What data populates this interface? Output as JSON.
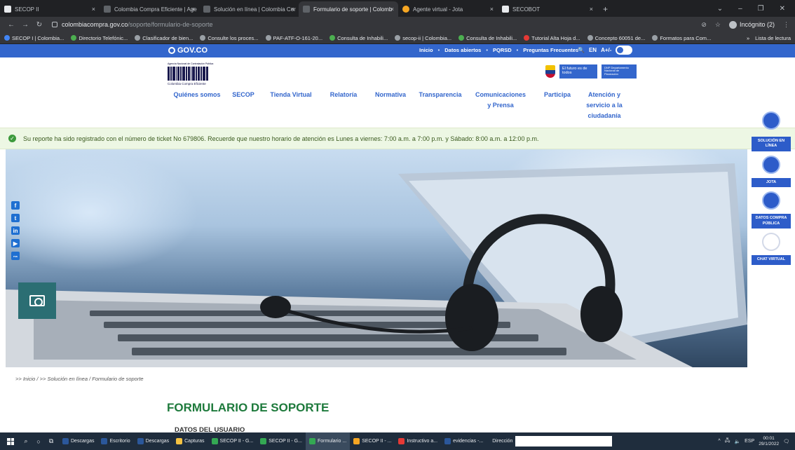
{
  "browser": {
    "tabs": [
      {
        "label": "SECOP II",
        "favicon": "white",
        "active": false
      },
      {
        "label": "Colombia Compra Eficiente | Age",
        "favicon": "gray",
        "active": false
      },
      {
        "label": "Solución en línea | Colombia Cor",
        "favicon": "gray",
        "active": false
      },
      {
        "label": "Formulario de soporte | Colomb",
        "favicon": "gray",
        "active": true
      },
      {
        "label": "Agente virtual - Jota",
        "favicon": "orange",
        "active": false
      },
      {
        "label": "SECOBOT",
        "favicon": "white",
        "active": false
      }
    ],
    "close_glyph": "×",
    "new_tab_glyph": "+",
    "window_controls": {
      "chevron": "⌄",
      "minimize": "–",
      "restore": "❐",
      "close": "✕"
    },
    "url_host": "colombiacompra.gov.co",
    "url_path": "/soporte/formulario-de-soporte",
    "incognito_label": "Incógnito (2)",
    "bookmarks": [
      {
        "label": "SECOP I | Colombia...",
        "color": "blue"
      },
      {
        "label": "Directorio Telefónic...",
        "color": "green"
      },
      {
        "label": "Clasificador de bien...",
        "color": "gray"
      },
      {
        "label": "Consulte los proces...",
        "color": "gray"
      },
      {
        "label": "PAF-ATF-O-161-20...",
        "color": "gray"
      },
      {
        "label": "Consulta de Inhabili...",
        "color": "green"
      },
      {
        "label": "secop-ii | Colombia...",
        "color": "gray"
      },
      {
        "label": "Consulta de Inhabili...",
        "color": "green"
      },
      {
        "label": "Tutorial Alta Hoja d...",
        "color": "red"
      },
      {
        "label": "Concepto 60051 de...",
        "color": "gray"
      },
      {
        "label": "Formatos para Com...",
        "color": "gray"
      }
    ],
    "bookmarks_more": "»",
    "reading_list": "Lista de lectura"
  },
  "gov_bar": {
    "logo": "GOV.CO",
    "links": [
      "Inicio",
      "Datos abiertos",
      "PQRSD",
      "Preguntas Frecuentes"
    ],
    "lang": "EN",
    "contrast": "A+/-"
  },
  "header": {
    "cce_small": "Agencia Nacional de Contratación Pública",
    "cce_brand": "Colombia Compra Eficiente",
    "dnp_slogan": "El futuro es de todos",
    "dnp_name": "DNP Departamento Nacional de Planeación"
  },
  "nav": [
    {
      "label": "Quiénes somos"
    },
    {
      "label": "SECOP"
    },
    {
      "label": "Tienda Virtual"
    },
    {
      "label": "Relatoría"
    },
    {
      "label": "Normativa"
    },
    {
      "label": "Transparencia"
    },
    {
      "label": "Comunicaciones\ny Prensa"
    },
    {
      "label": "Participa"
    },
    {
      "label": "Atención y\nservicio a la\nciudadanía"
    }
  ],
  "alert": {
    "message": "Su reporte ha sido registrado con el número de ticket No 679806. Recuerde que nuestro horario de atención es Lunes a viernes: 7:00 a.m. a 7:00 p.m. y Sábado: 8:00 a.m. a 12:00 p.m."
  },
  "socials": [
    "f",
    "t",
    "in",
    "▶",
    "rss"
  ],
  "side_tools": [
    {
      "label": "SOLUCIÓN EN LÍNEA"
    },
    {
      "label": "JOTA"
    },
    {
      "label": "DATOS COMPRA PÚBLICA"
    },
    {
      "label": "CHAT VIRTUAL"
    }
  ],
  "breadcrumb": ">> Inicio / >> Solución en línea / Formulario de soporte",
  "form": {
    "title": "FORMULARIO DE SOPORTE",
    "section": "DATOS DEL USUARIO"
  },
  "taskbar": {
    "items": [
      {
        "label": "Descargas",
        "color": "b"
      },
      {
        "label": "Escritorio",
        "color": "b"
      },
      {
        "label": "Descargas",
        "color": "b"
      },
      {
        "label": "Capturas",
        "color": "y"
      },
      {
        "label": "SECOP II - G...",
        "color": "g"
      },
      {
        "label": "SECOP II - G...",
        "color": "g"
      },
      {
        "label": "Formulario ...",
        "color": "g"
      },
      {
        "label": "SECOP II - ...",
        "color": "o"
      },
      {
        "label": "Instructivo a...",
        "color": "r"
      },
      {
        "label": "evidencias -...",
        "color": "b"
      }
    ],
    "address_label": "Dirección",
    "lang": "ESP",
    "time": "00:01",
    "date": "29/1/2022"
  }
}
